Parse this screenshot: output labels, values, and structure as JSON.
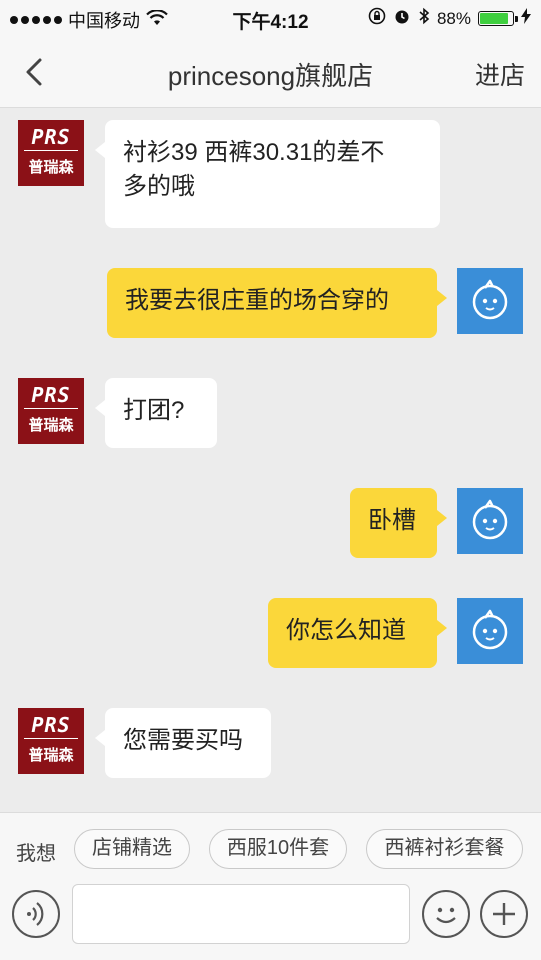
{
  "status_bar": {
    "carrier": "中国移动",
    "time": "下午4:12",
    "battery": "88%",
    "battery_level": 0.88
  },
  "header": {
    "title": "princesong旗舰店",
    "enter_store": "进店"
  },
  "shop_avatar": {
    "logo_text": "PRS",
    "logo_cn": "普瑞森"
  },
  "messages": [
    {
      "side": "left",
      "text_line1": "衬衫39  西裤30.31的差不",
      "text_line2": "多的哦"
    },
    {
      "side": "right",
      "text": "我要去很庄重的场合穿的"
    },
    {
      "side": "left",
      "text": "打团?"
    },
    {
      "side": "right",
      "text": "卧槽"
    },
    {
      "side": "right",
      "text": "你怎么知道"
    },
    {
      "side": "left",
      "text": "您需要买吗"
    }
  ],
  "quick_replies": {
    "label": "我想",
    "options": [
      "店铺精选",
      "西服10件套",
      "西裤衬衫套餐"
    ]
  },
  "input_bar": {
    "placeholder": "",
    "voice_icon": "voice-icon",
    "emoji_icon": "emoji-icon",
    "plus_icon": "plus-icon"
  },
  "colors": {
    "shop_avatar_bg": "#8b1117",
    "my_avatar_bg": "#3a8ed8",
    "my_bubble": "#fbd73a",
    "their_bubble": "#ffffff",
    "chat_bg": "#ececec"
  }
}
